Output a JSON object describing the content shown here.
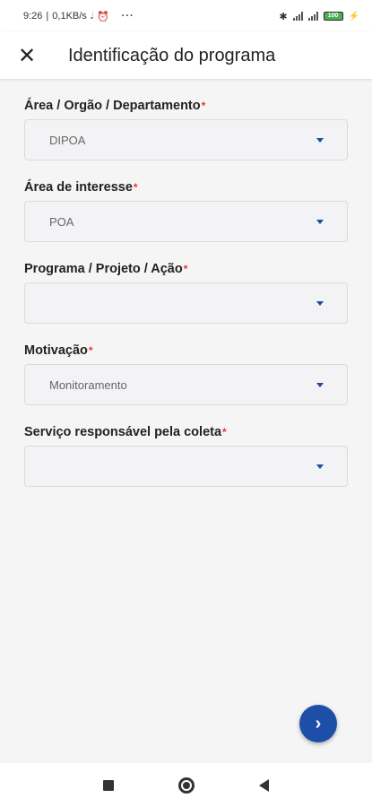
{
  "status_bar": {
    "time": "9:26",
    "speed": "0,1KB/s",
    "more": "···",
    "battery": "100"
  },
  "app_bar": {
    "close_glyph": "✕",
    "title": "Identificação do programa"
  },
  "form": {
    "fields": [
      {
        "label": "Área / Orgão / Departamento",
        "required": "*",
        "value": "DIPOA"
      },
      {
        "label": "Área de interesse",
        "required": "*",
        "value": "POA"
      },
      {
        "label": "Programa / Projeto / Ação",
        "required": "*",
        "value": ""
      },
      {
        "label": "Motivação",
        "required": "*",
        "value": "Monitoramento"
      },
      {
        "label": "Serviço responsável pela coleta",
        "required": "*",
        "value": ""
      }
    ]
  },
  "fab": {
    "icon": "chevron-right-icon",
    "glyph": "›"
  },
  "colors": {
    "accent": "#1e4fa8",
    "required": "#e53935",
    "caret": "#1c4b9c"
  }
}
